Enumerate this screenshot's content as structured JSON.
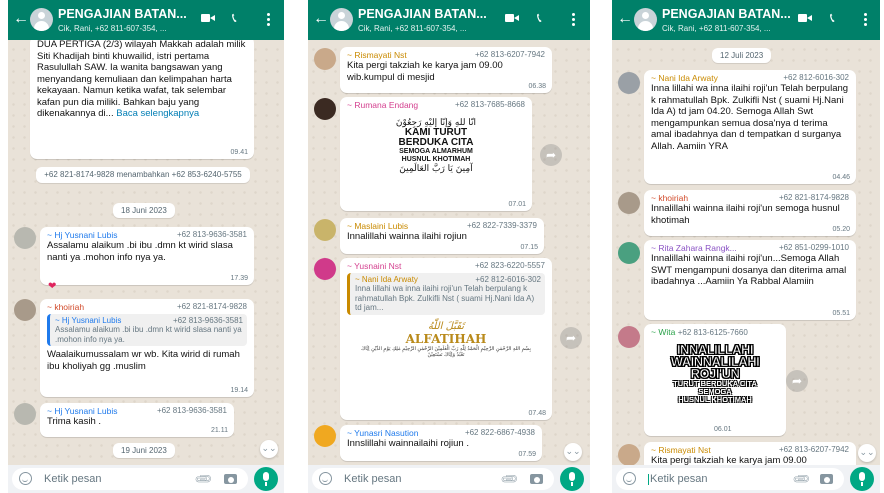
{
  "colors": {
    "header": "#008069",
    "accent": "#00a884",
    "chat_bg": "#e9e2d8",
    "link": "#027eb5",
    "timestamp": "#667781"
  },
  "header": {
    "title": "PENGAJIAN BATAN...",
    "subtitle": "Cik, Rani, +62 811-607-354, ..."
  },
  "input_placeholder": "Ketik pesan",
  "p1": {
    "m1": {
      "text": "DUA PERTIGA (2/3) wilayah Makkah adalah milik Siti Khadijah binti khuwailid, istri pertama Rasulullah SAW. Ia wanita bangsawan yang menyandang kemuliaan dan kelimpahan harta kekayaan. Namun ketika wafat, tak selembar kafan pun dia miliki. Bahkan baju yang dikenakannya di...",
      "more": "Baca selengkapnya",
      "time": "09.41"
    },
    "sys": "+62 821-8174-9828 menambahkan +62 853-6240-5755",
    "date": "18 Juni 2023",
    "m2": {
      "name": "~ Hj Yusnani Lubis",
      "phone": "+62 813-9636-3581",
      "text": "Assalamu alaikum .bi ibu .dmn kt wirid  slasa nanti ya  .mohon info nya ya.",
      "time": "17.39",
      "reaction": "❤"
    },
    "m3": {
      "name": "~ khoiriah",
      "phone": "+62 821-8174-9828",
      "q_name": "~ Hj Yusnani Lubis",
      "q_phone": "+62 813-9636-3581",
      "q_text": "Assalamu alaikum .bi ibu .dmn kt wirid slasa nanti ya  .mohon info nya ya.",
      "text": "Waalaikumussalam wr wb. Kita wirid di rumah ibu kholiyah gg .muslim",
      "time": "19.14"
    },
    "m4": {
      "name": "~ Hj Yusnani Lubis",
      "phone": "+62 813-9636-3581",
      "text": "Trima kasih .",
      "time": "21.11"
    },
    "date2": "19 Juni 2023"
  },
  "p2": {
    "m1": {
      "name": "~ Rismayati Nst",
      "phone": "+62 813-6207-7942",
      "text": "Kita pergi takziah ke karya jam 09.00 wib.kumpul di mesjid",
      "time": "06.38"
    },
    "m2": {
      "name": "~ Rumana Endang",
      "phone": "+62 813-7685-8668",
      "img_ar1": "انّا للهِ وَإنّا إليْهِ رَجِعُوْنَ",
      "img_l1": "KAMI TURUT",
      "img_l2": "BERDUKA CITA",
      "img_l3": "SEMOGA ALMARHUM",
      "img_l4": "HUSNUL KHOTIMAH",
      "img_ar2": "آمِينَ يَا رَبَّ العَالَمِينَ",
      "time": "07.01"
    },
    "m3": {
      "name": "~ Maslaini Lubis",
      "phone": "+62 822-7339-3379",
      "text": "Innalillahi wainna ilaihi rojiun",
      "time": "07.15"
    },
    "m4": {
      "name": "~ Yusnaini Nst",
      "phone": "+62 823-6220-5557",
      "q_name": "~ Nani Ida Arwaty",
      "q_phone": "+62 812-6016-302",
      "q_text": "Inna lillahi wa inna ilaihi roji'un Telah berpulang k rahmatullah Bpk. Zulkifli Nst ( suami Hj.Nani Ida A) td jam...",
      "img_ar": "تَقَبَّلَ اللّٰهُ",
      "img_title": "ALFATIHAH",
      "img_small": "بِسْمِ اللهِ الرَّحْمٰنِ الرَّحِيْمِ  الْحَمْدُ لِلّٰهِ رَبِّ الْعٰلَمِيْنَ  الرَّحْمٰنِ الرَّحِيْمِ  مٰلِكِ يَوْمِ الدِّيْنِ  اِيَّاكَ نَعْبُدُ وَاِيَّاكَ نَسْتَعِيْنُ",
      "time": "07.48"
    },
    "m5": {
      "name": "~ Yunasri Nasution",
      "phone": "+62 822-6867-4938",
      "text": "Innslillahi wainnailaihi rojiun .",
      "time": "07.59"
    }
  },
  "p3": {
    "date": "12 Juli 2023",
    "m1": {
      "name": "~ Nani Ida Arwaty",
      "phone": "+62 812-6016-302",
      "text": "Inna lillahi wa inna ilaihi roji'un Telah berpulang k rahmatullah Bpk. Zulkifli Nst ( suami Hj.Nani Ida A) td jam 04.20. Semoga Allah Swt mengampunkan semua dosa'nya d terima amal ibadahnya dan d tempatkan d surganya Allah. Aamiin YRA",
      "time": "04.46"
    },
    "m2": {
      "name": "~ khoiriah",
      "phone": "+62 821-8174-9828",
      "text": "Innalillahi wainna ilaihi roji'un semoga husnul khotimah",
      "time": "05.20"
    },
    "m3": {
      "name": "~ Rita Zahara Rangk...",
      "phone": "+62 851-0299-1010",
      "text": "Innalillahi wainna ilaihi roji'un...Semoga Allah SWT mengampuni dosanya dan diterima amal ibadahnya ...Aamiin Ya Rabbal Alamiin",
      "time": "05.51"
    },
    "m4": {
      "name": "~ Wita",
      "phone": "+62 813-6125-7660",
      "img_l1": "INNALILLAHI",
      "img_l2": "WAINNALILAHI",
      "img_l3": "ROJI'UN",
      "img_l4": "TURUT BERDUKA CITA",
      "img_l5": "SEMOGA",
      "img_l6": "HUSNUL KHOTIMAH",
      "time": "06.01"
    },
    "m5": {
      "name": "~ Rismayati Nst",
      "phone": "+62 813-6207-7942",
      "text": "Kita pergi takziah ke karya jam 09.00"
    }
  }
}
